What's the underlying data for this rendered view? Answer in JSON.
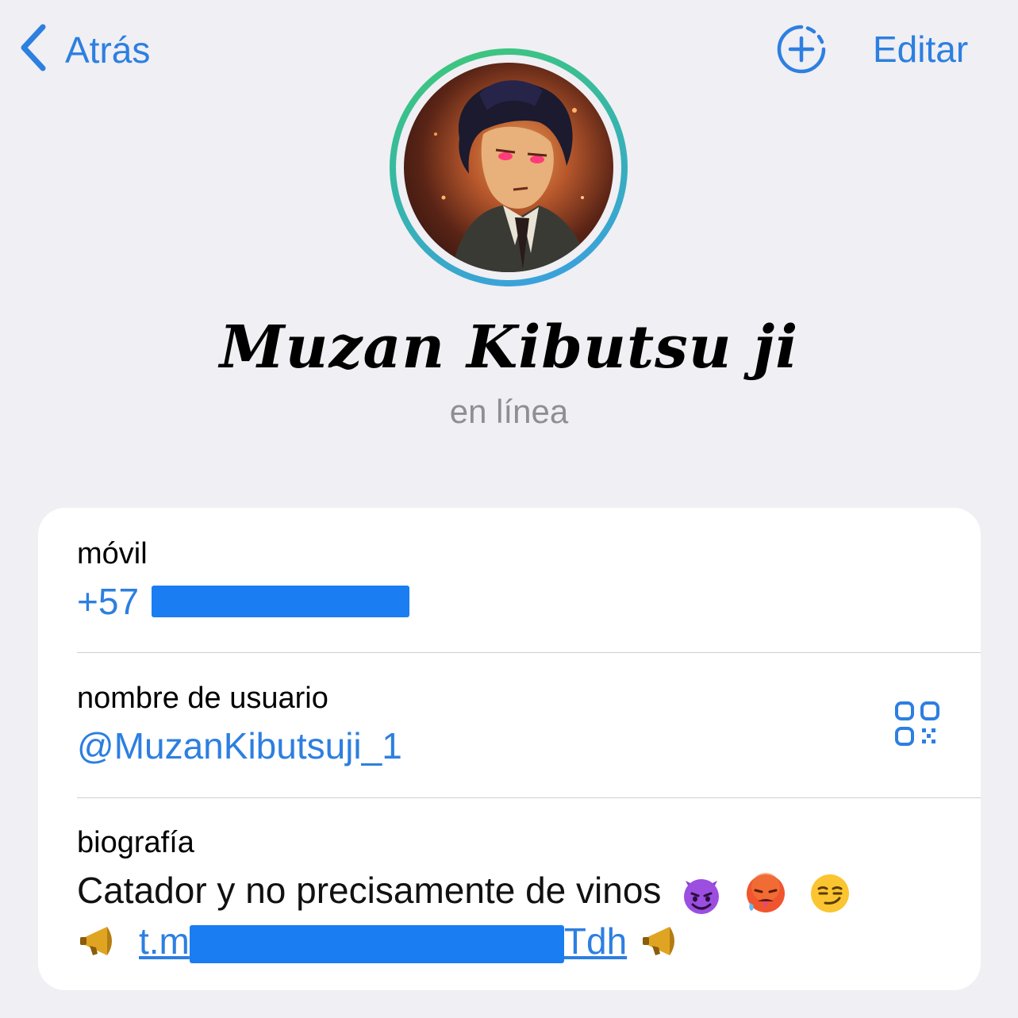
{
  "nav": {
    "back_label": "Atrás",
    "edit_label": "Editar"
  },
  "profile": {
    "name": "Muzan Kibutsu ji",
    "status": "en línea"
  },
  "info": {
    "phone": {
      "label": "móvil",
      "prefix": "+57"
    },
    "username": {
      "label": "nombre de usuario",
      "value": "@MuzanKibutsuji_1"
    },
    "bio": {
      "label": "biografía",
      "text": "Catador y no precisamente de vinos",
      "link_start": "t.m",
      "link_end": "Tdh"
    }
  },
  "icons": {
    "back": "chevron-left-icon",
    "story": "add-story-icon",
    "qr": "qr-code-icon",
    "emojis": [
      "smiling-devil-emoji",
      "hot-face-emoji",
      "smirking-face-emoji",
      "megaphone-emoji"
    ]
  },
  "colors": {
    "accent": "#2d7fe0",
    "background": "#efeff4",
    "redaction": "#1a7df2",
    "ring_start": "#3fca72",
    "ring_end": "#3b9ce8"
  }
}
